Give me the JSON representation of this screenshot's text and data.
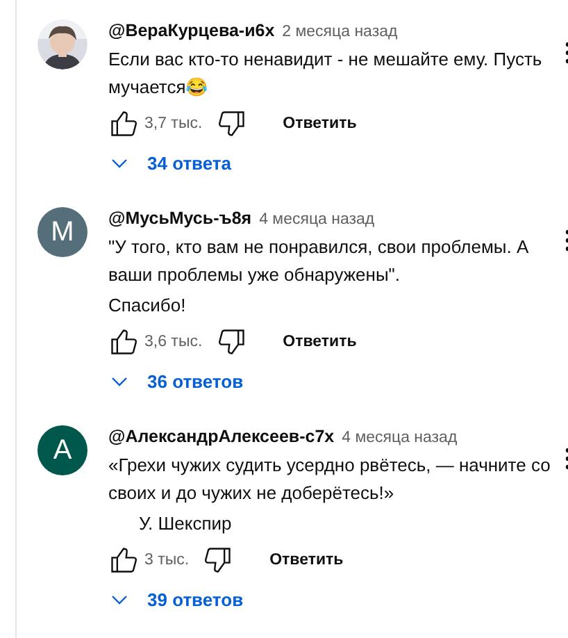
{
  "comments": [
    {
      "author": "@ВераКурцева-и6х",
      "time": "2 месяца назад",
      "avatar": {
        "kind": "picture"
      },
      "paragraphs": [
        {
          "text": "Если вас кто-то ненавидит - не мешайте ему. Пусть мучается😂",
          "indented": false
        }
      ],
      "likes": "3,7 тыс.",
      "reply_label": "Ответить",
      "replies": "34 ответа"
    },
    {
      "author": "@МусьМусь-ъ8я",
      "time": "4 месяца назад",
      "avatar": {
        "kind": "letter",
        "letter": "М",
        "color": "#546e7a"
      },
      "paragraphs": [
        {
          "text": "\"У того, кто вам не понравился, свои проблемы. А ваши проблемы уже обнаружены\".",
          "indented": false
        },
        {
          "text": "Спасибо!",
          "indented": false
        }
      ],
      "likes": "3,6 тыс.",
      "reply_label": "Ответить",
      "replies": "36 ответов"
    },
    {
      "author": "@АлександрАлексеев-с7х",
      "time": "4 месяца назад",
      "avatar": {
        "kind": "letter",
        "letter": "А",
        "color": "#00574b"
      },
      "paragraphs": [
        {
          "text": "«Грехи чужих судить усердно рвётесь, — начните со своих и до чужих не доберётесь!»",
          "indented": false
        },
        {
          "text": "У. Шекспир",
          "indented": true
        }
      ],
      "likes": "3 тыс.",
      "reply_label": "Ответить",
      "replies": "39 ответов"
    }
  ]
}
